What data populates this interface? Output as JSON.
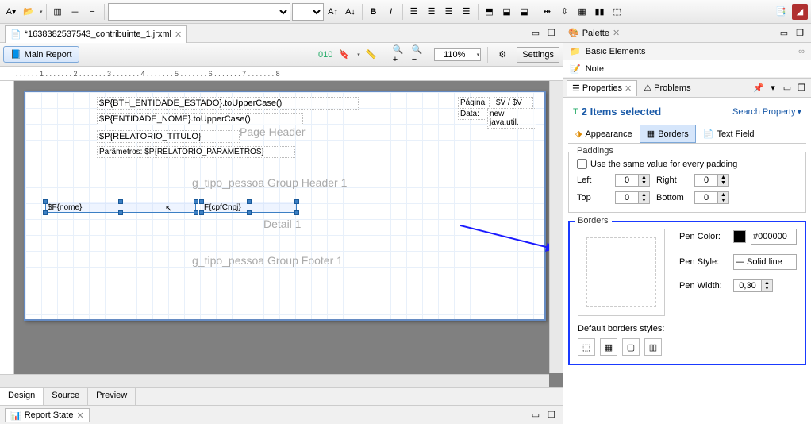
{
  "toolbar": {
    "font_select": "",
    "size_select": ""
  },
  "editor": {
    "tab_title": "*1638382537543_contribuinte_1.jrxml"
  },
  "subtoolbar": {
    "main_report": "Main Report",
    "zoom": "110%",
    "settings": "Settings"
  },
  "report": {
    "fields": {
      "estado": "$P{BTH_ENTIDADE_ESTADO}.toUpperCase()",
      "nome": "$P{ENTIDADE_NOME}.toUpperCase()",
      "titulo": "$P{RELATORIO_TITULO}",
      "parametros": "Parâmetros: $P{RELATORIO_PARAMETROS}",
      "pagina_label": "Página:",
      "pagina_val": "$V /  $V",
      "data_label": "Data:",
      "data_val": "new java.util.",
      "f_nome": "$F{nome}",
      "f_cpf": "F{cpfCnpj}"
    },
    "bands": {
      "page_header": "Page Header",
      "group_header": "g_tipo_pessoa Group Header 1",
      "detail": "Detail 1",
      "group_footer": "g_tipo_pessoa Group Footer 1"
    }
  },
  "bottom_tabs": {
    "design": "Design",
    "source": "Source",
    "preview": "Preview"
  },
  "report_state": {
    "label": "Report State"
  },
  "palette": {
    "title": "Palette",
    "basic": "Basic Elements",
    "note": "Note"
  },
  "properties": {
    "tab_properties": "Properties",
    "tab_problems": "Problems",
    "selection": "2 Items selected",
    "search": "Search Property",
    "tab_appearance": "Appearance",
    "tab_borders": "Borders",
    "tab_textfield": "Text Field",
    "paddings": {
      "legend": "Paddings",
      "same": "Use the same value for every padding",
      "left": "Left",
      "right": "Right",
      "top": "Top",
      "bottom": "Bottom",
      "left_v": "0",
      "right_v": "0",
      "top_v": "0",
      "bottom_v": "0"
    },
    "borders": {
      "legend": "Borders",
      "pen_color": "Pen Color:",
      "pen_color_val": "#000000",
      "pen_style": "Pen Style:",
      "pen_style_val": "— Solid line",
      "pen_width": "Pen Width:",
      "pen_width_val": "0,30",
      "default_styles": "Default borders styles:"
    }
  },
  "ruler": {
    "ticks": ". . . . . . 1 . . . . . . . 2 . . . . . . . 3 . . . . . . . 4 . . . . . . . 5 . . . . . . . 6 . . . . . . . 7 . . . . . . . 8"
  }
}
